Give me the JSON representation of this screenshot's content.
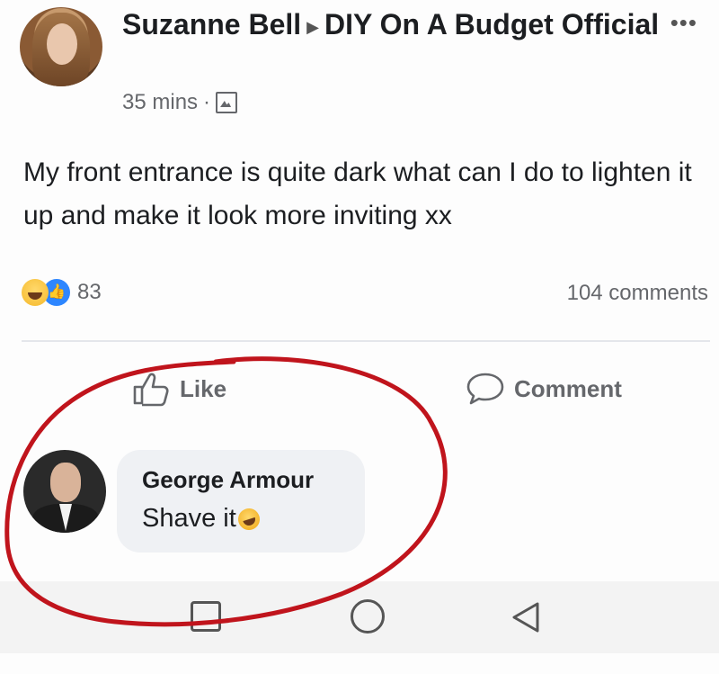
{
  "post": {
    "author": "Suzanne Bell",
    "group": "DIY On A Budget Official",
    "time": "35 mins",
    "separator": "·",
    "text": "My front entrance is quite dark what can I do to lighten it up and make it look more inviting xx",
    "reaction_count": "83",
    "comments_count": "104 comments",
    "more_icon": "•••"
  },
  "actions": {
    "like_label": "Like",
    "comment_label": "Comment"
  },
  "comment": {
    "author": "George Armour",
    "text": "Shave it"
  },
  "colors": {
    "annotation": "#c0141c",
    "secondary_text": "#65676b",
    "bubble": "#eff1f4",
    "like_blue": "#2d86ff"
  }
}
